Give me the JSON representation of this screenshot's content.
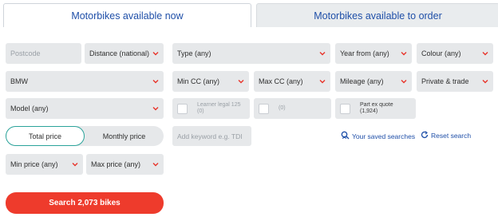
{
  "tabs": {
    "available_now": "Motorbikes available now",
    "available_to_order": "Motorbikes available to order"
  },
  "filters": {
    "postcode_placeholder": "Postcode",
    "distance": "Distance (national)",
    "type": "Type (any)",
    "year_from": "Year from (any)",
    "colour": "Colour (any)",
    "make": "BMW",
    "min_cc": "Min CC (any)",
    "max_cc": "Max CC (any)",
    "mileage": "Mileage (any)",
    "seller": "Private & trade",
    "model": "Model (any)",
    "min_price": "Min price (any)",
    "max_price": "Max price (any)"
  },
  "checks": {
    "learner_legal_line1": "Learner legal 125",
    "learner_legal_line2": "(0)",
    "unnamed_count": "(0)",
    "part_ex_line1": "Part ex quote",
    "part_ex_line2": "(1,924)"
  },
  "price_toggle": {
    "total": "Total price",
    "monthly": "Monthly price"
  },
  "keyword_placeholder": "Add keyword e.g. TDI",
  "links": {
    "saved_searches": "Your saved searches",
    "reset_search": "Reset search"
  },
  "search_button": "Search 2,073 bikes",
  "colors": {
    "accent_blue": "#1f4fa8",
    "chevron_red": "#e8342a",
    "toggle_teal": "#2aa39a",
    "search_red": "#ee3b2c"
  }
}
